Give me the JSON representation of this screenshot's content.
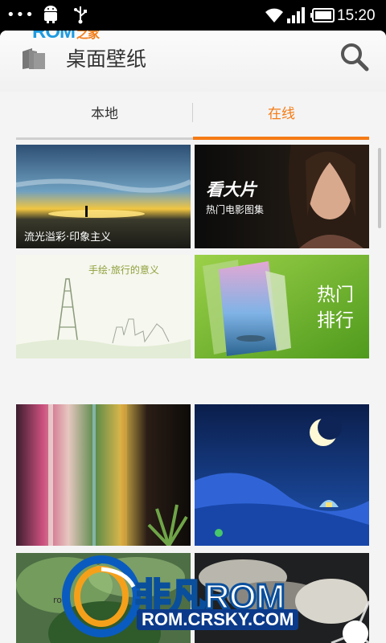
{
  "status_bar": {
    "notification_dots": "•••",
    "time": "15:20",
    "icons": [
      "android-debug-icon",
      "usb-icon",
      "wifi-icon",
      "signal-icon",
      "battery-icon"
    ]
  },
  "watermark_top": {
    "brand": "ROM",
    "suffix": "之家"
  },
  "header": {
    "title": "桌面壁纸",
    "icons": [
      "wallpaper-stack-icon",
      "search-icon"
    ]
  },
  "tabs": [
    {
      "label": "本地",
      "active": false
    },
    {
      "label": "在线",
      "active": true
    }
  ],
  "accent_color": "#f57b14",
  "tiles": [
    {
      "caption": "流光溢彩·印象主义"
    },
    {
      "caption_main": "看大片",
      "caption_sub": "热门电影图集"
    },
    {
      "caption": "手绘·旅行的意义"
    },
    {
      "caption": "热门\n排行",
      "caption_line1": "热门",
      "caption_line2": "排行"
    }
  ],
  "watermark_bottom": {
    "brand": "非凡ROM",
    "url": "ROM.CRSKY.COM",
    "small_text": "ro"
  }
}
